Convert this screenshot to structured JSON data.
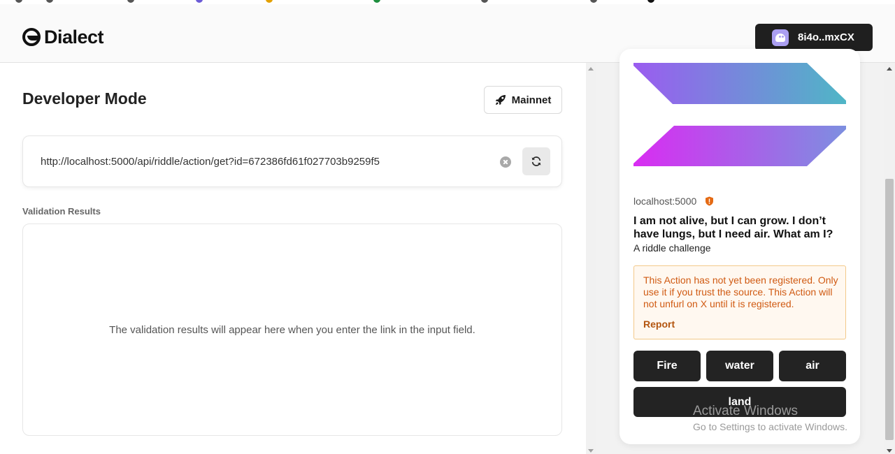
{
  "header": {
    "brand": "Dialect",
    "wallet_label": "8i4o..mxCX"
  },
  "main": {
    "title": "Developer Mode",
    "network_label": "Mainnet",
    "url_value": "http://localhost:5000/api/riddle/action/get?id=672386fd61f027703b9259f5",
    "validation_label": "Validation Results",
    "validation_placeholder": "The validation results will appear here when you enter the link in the input field."
  },
  "blink": {
    "domain": "localhost:5000",
    "title": "I am not alive, but I can grow. I don’t have lungs, but I need air. What am I?",
    "description": "A riddle challenge",
    "warning_text": "This Action has not yet been registered. Only use it if you trust the source. This Action will not unfurl on X until it is registered.",
    "report_label": "Report",
    "options": [
      "Fire",
      "water",
      "air",
      "land"
    ]
  },
  "overlay": {
    "line1": "Activate Windows",
    "line2": "Go to Settings to activate Windows."
  },
  "colors": {
    "dark_button": "#232323",
    "warning_text": "#d05a12",
    "warning_border": "#f3c98a",
    "wallet_icon": "#ab9ff2"
  }
}
